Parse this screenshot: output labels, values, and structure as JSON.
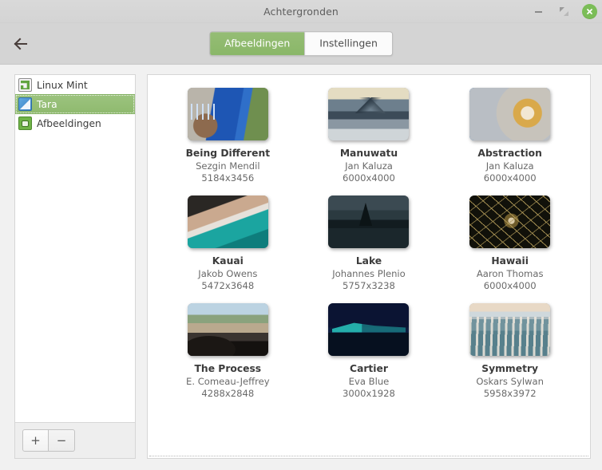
{
  "window": {
    "title": "Achtergronden",
    "minimize_label": "Minimaliseren",
    "maximize_label": "Maximaliseren",
    "close_label": "Sluiten"
  },
  "header": {
    "back_label": "Terug",
    "tabs": [
      {
        "label": "Afbeeldingen",
        "active": true
      },
      {
        "label": "Instellingen",
        "active": false
      }
    ]
  },
  "sidebar": {
    "items": [
      {
        "label": "Linux Mint",
        "icon": "mint-logo-icon",
        "selected": false
      },
      {
        "label": "Tara",
        "icon": "wallpaper-icon",
        "selected": true
      },
      {
        "label": "Afbeeldingen",
        "icon": "pictures-folder-icon",
        "selected": false
      }
    ],
    "actions": {
      "add_label": "+",
      "remove_label": "−"
    }
  },
  "colors": {
    "accent_green": "#8ab768",
    "selected_row": "#95bd75",
    "titlebar": "#d6d6d6",
    "window_bg": "#f1f1f1",
    "close_button": "#7bbd57"
  },
  "gallery": {
    "items": [
      {
        "name": "Being Different",
        "author": "Sezgin Mendil",
        "dimensions": "5184x3456",
        "art": "art-being-different"
      },
      {
        "name": "Manuwatu",
        "author": "Jan Kaluza",
        "dimensions": "6000x4000",
        "art": "art-manuwatu"
      },
      {
        "name": "Abstraction",
        "author": "Jan Kaluza",
        "dimensions": "6000x4000",
        "art": "art-abstraction"
      },
      {
        "name": "Kauai",
        "author": "Jakob Owens",
        "dimensions": "5472x3648",
        "art": "art-kauai"
      },
      {
        "name": "Lake",
        "author": "Johannes Plenio",
        "dimensions": "5757x3238",
        "art": "art-lake"
      },
      {
        "name": "Hawaii",
        "author": "Aaron Thomas",
        "dimensions": "6000x4000",
        "art": "art-hawaii"
      },
      {
        "name": "The Process",
        "author": "E. Comeau-Jeffrey",
        "dimensions": "4288x2848",
        "art": "art-the-process"
      },
      {
        "name": "Cartier",
        "author": "Eva Blue",
        "dimensions": "3000x1928",
        "art": "art-cartier"
      },
      {
        "name": "Symmetry",
        "author": "Oskars Sylwan",
        "dimensions": "5958x3972",
        "art": "art-symmetry"
      }
    ]
  }
}
